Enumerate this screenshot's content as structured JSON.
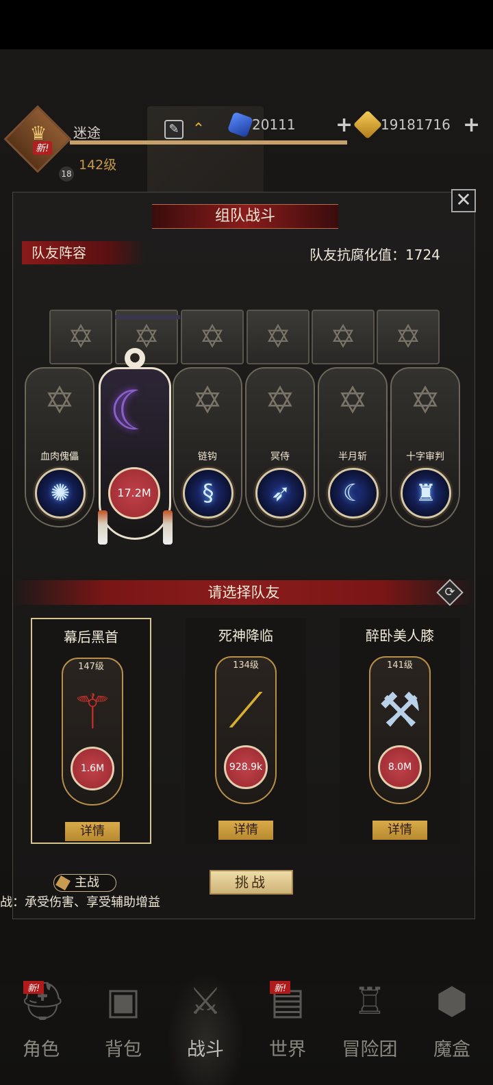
{
  "hud": {
    "player_name": "迷途",
    "player_level": "142级",
    "new_badge": "新!",
    "avatar_level": "18",
    "gems": "20111",
    "gold": "19181716",
    "plus": "+"
  },
  "modal": {
    "title": "组队战斗",
    "close_label": "✕",
    "team_lineup_label": "队友阵容",
    "resistance_label": "队友抗腐化值：1724",
    "select_teammate_label": "请选择队友",
    "refresh_glyph": "⟳"
  },
  "leader": {
    "power": "17.2M",
    "weapon_icon": "scythe-icon"
  },
  "skills": [
    {
      "name": "血肉傀儡",
      "glyph": "✺"
    },
    {
      "name": "链钩",
      "glyph": "§"
    },
    {
      "name": "冥侍",
      "glyph": "➶"
    },
    {
      "name": "半月斩",
      "glyph": "☾"
    },
    {
      "name": "十字审判",
      "glyph": "♜"
    }
  ],
  "teammates": [
    {
      "name": "幕后黑首",
      "level": "147级",
      "power": "1.6M",
      "detail": "详情",
      "selected": true,
      "weapon_glyph": "⚚"
    },
    {
      "name": "死神降临",
      "level": "134级",
      "power": "928.9k",
      "detail": "详情",
      "selected": false,
      "weapon_glyph": "⟋"
    },
    {
      "name": "醉卧美人膝",
      "level": "141级",
      "power": "8.0M",
      "detail": "详情",
      "selected": false,
      "weapon_glyph": "⚒"
    }
  ],
  "footer": {
    "main_battle_tag": "主战",
    "main_battle_desc": "战：承受伤害、享受辅助增益",
    "challenge_button": "挑战"
  },
  "nav": [
    {
      "label": "角色",
      "icon": "helmet-icon",
      "glyph": "⛑",
      "new": "新!"
    },
    {
      "label": "背包",
      "icon": "backpack-icon",
      "glyph": "🎒",
      "new": ""
    },
    {
      "label": "战斗",
      "icon": "shield-sword-icon",
      "glyph": "⚔",
      "new": ""
    },
    {
      "label": "世界",
      "icon": "map-chest-icon",
      "glyph": "▤",
      "new": "新!"
    },
    {
      "label": "冒险团",
      "icon": "castle-icon",
      "glyph": "♖",
      "new": ""
    },
    {
      "label": "魔盒",
      "icon": "cube-icon",
      "glyph": "⬢",
      "new": ""
    }
  ],
  "colors": {
    "accent_red": "#8a1c1c",
    "gold_button": "#d8aa48",
    "power_orb": "#c0424a"
  }
}
